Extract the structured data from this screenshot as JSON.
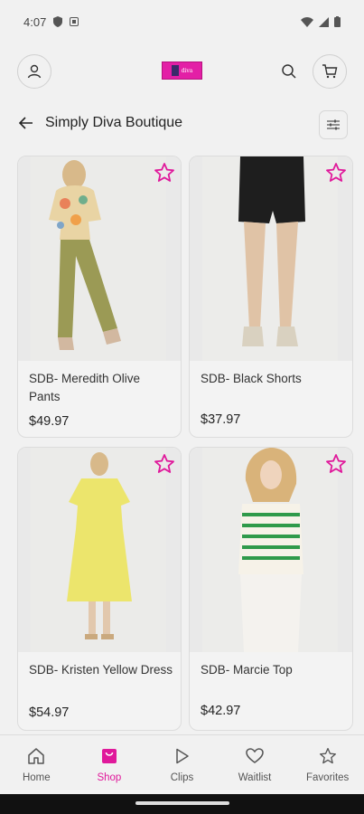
{
  "status": {
    "time": "4:07"
  },
  "header": {
    "logo_alt": "Simply Diva Boutique logo",
    "icons": [
      "account-icon",
      "search-icon",
      "cart-icon"
    ]
  },
  "store": {
    "title": "Simply Diva Boutique"
  },
  "products": [
    {
      "name": "SDB- Meredith Olive Pants",
      "price": "$49.97"
    },
    {
      "name": "SDB- Black Shorts",
      "price": "$37.97"
    },
    {
      "name": "SDB- Kristen Yellow Dress",
      "price": "$54.97"
    },
    {
      "name": "SDB- Marcie Top",
      "price": "$42.97"
    }
  ],
  "nav": [
    {
      "label": "Home",
      "icon": "home-icon"
    },
    {
      "label": "Shop",
      "icon": "shop-bag-icon",
      "active": true
    },
    {
      "label": "Clips",
      "icon": "play-icon"
    },
    {
      "label": "Waitlist",
      "icon": "heart-icon"
    },
    {
      "label": "Favorites",
      "icon": "star-icon"
    }
  ],
  "colors": {
    "accent": "#e0199b",
    "background": "#f1f1f1"
  }
}
